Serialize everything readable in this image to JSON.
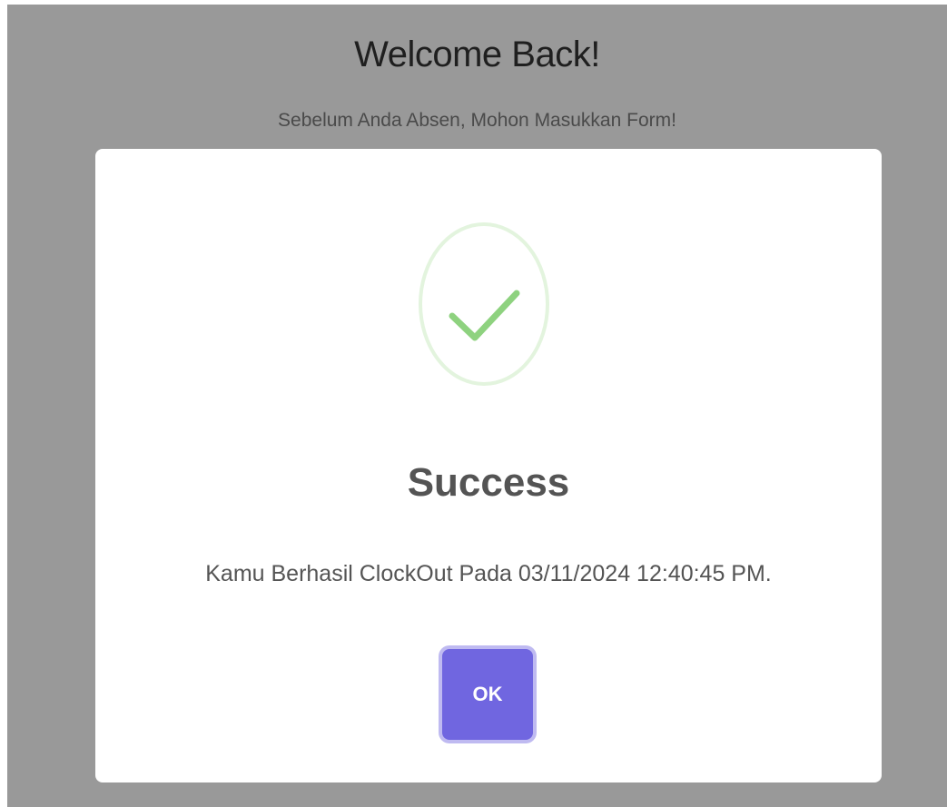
{
  "background": {
    "title": "Welcome Back!",
    "subtitle": "Sebelum Anda Absen, Mohon Masukkan Form!"
  },
  "dialog": {
    "icon": "success-check-icon",
    "title": "Success",
    "message": "Kamu Berhasil ClockOut Pada 03/11/2024 12:40:45 PM.",
    "confirm_label": "OK"
  },
  "colors": {
    "backdrop": "#999999",
    "check": "#8ed27f",
    "ring": "#e3f4de",
    "button": "#7066e0"
  }
}
